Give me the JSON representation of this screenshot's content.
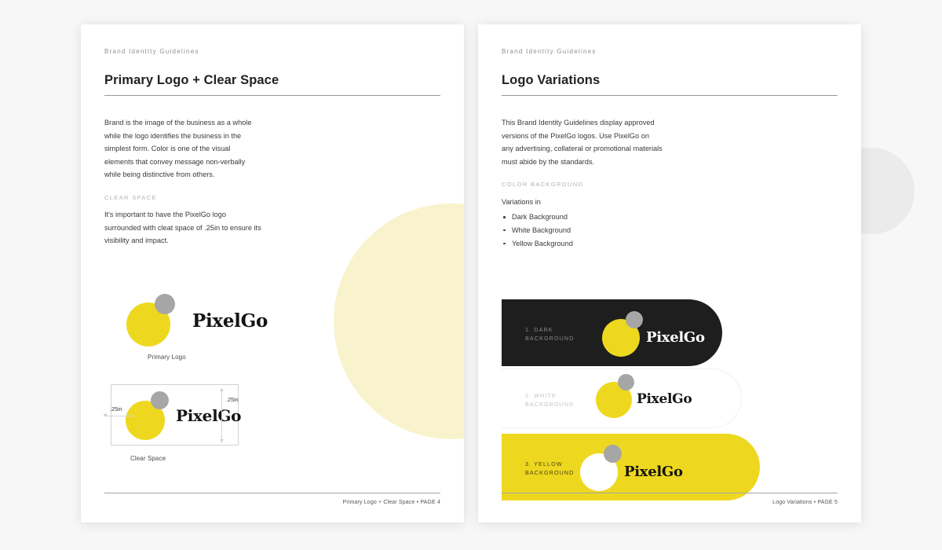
{
  "document": {
    "background_color": "#f7f7f7",
    "brand_yellow": "#eed81f",
    "brand_pale_yellow": "#f8f3cd",
    "brand_gray": "#a6a6a6",
    "brand_dark": "#1e1e1e",
    "brand_name": "PixelGo"
  },
  "decor": {
    "gray_circle": "decorative-gray-circle",
    "yellow_circle": "decorative-pale-yellow-circle"
  },
  "pages": [
    {
      "eyebrow": "Brand Identity Guidelines",
      "title": "Primary Logo + Clear Space",
      "body": "Brand is the image of the business as a whole while the logo identifies the business in the simplest form. Color is one of the visual elements that convey message non-verbally while being distinctive from others.",
      "section_label": "CLEAR SPACE",
      "sub_body": "It's important to have the PixelGo logo surrounded with cleat space of .25in to ensure its visibility and impact.",
      "primary_logo": {
        "wordmark": "PixelGo",
        "caption": "Primary Logo"
      },
      "clear_space": {
        "wordmark": "PixelGo",
        "caption": "Clear Space",
        "dimension_left": ".25in",
        "dimension_right": ".25in"
      },
      "footer": "Primary Logo + Clear Space • PAGE 4"
    },
    {
      "eyebrow": "Brand Identity Guidelines",
      "title": "Logo Variations",
      "body": "This Brand Identity Guidelines display approved versions of the PixelGo logos. Use PixelGo on any advertising, collateral or promotional materials must abide by the standards.",
      "section_label": "COLOR BACKGROUND",
      "lead": "Variations in",
      "bullets": [
        "Dark Background",
        "White Background",
        "Yellow Background"
      ],
      "variations": [
        {
          "label": "1. DARK\nBACKGROUND",
          "wordmark": "PixelGo"
        },
        {
          "label": "2. WHITE\nBACKGROUND",
          "wordmark": "PixelGo"
        },
        {
          "label": "3. YELLOW\nBACKGROUND",
          "wordmark": "PixelGo"
        }
      ],
      "footer": "Logo Variations • PAGE 5"
    }
  ]
}
